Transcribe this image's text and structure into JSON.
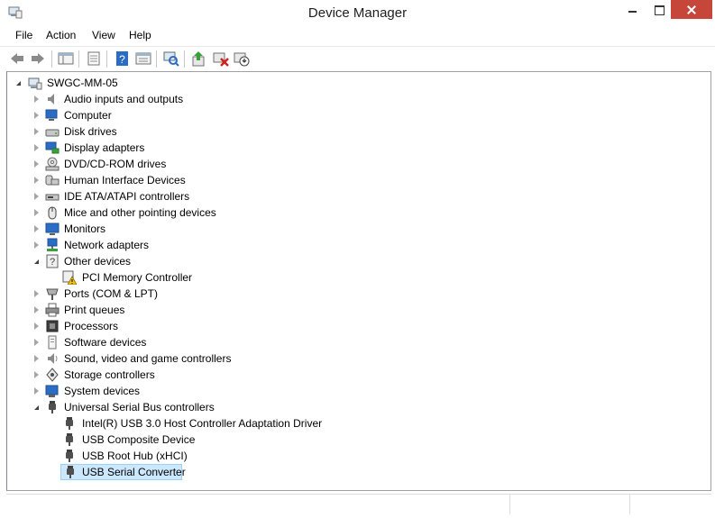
{
  "window": {
    "title": "Device Manager"
  },
  "menu": [
    "File",
    "Action",
    "View",
    "Help"
  ],
  "toolbar": [
    "back-arrow-icon",
    "forward-arrow-icon",
    "show-hide-console-tree-icon",
    "properties-icon",
    "help-icon",
    "view-icon",
    "scan-hardware-icon",
    "update-driver-icon",
    "uninstall-device-icon",
    "disable-device-icon"
  ],
  "tree": {
    "root": "SWGC-MM-05",
    "categories": [
      {
        "label": "Audio inputs and outputs",
        "icon": "speaker-icon",
        "expanded": false
      },
      {
        "label": "Computer",
        "icon": "computer-icon",
        "expanded": false
      },
      {
        "label": "Disk drives",
        "icon": "disk-drive-icon",
        "expanded": false
      },
      {
        "label": "Display adapters",
        "icon": "display-adapter-icon",
        "expanded": false
      },
      {
        "label": "DVD/CD-ROM drives",
        "icon": "dvd-drive-icon",
        "expanded": false
      },
      {
        "label": "Human Interface Devices",
        "icon": "hid-icon",
        "expanded": false
      },
      {
        "label": "IDE ATA/ATAPI controllers",
        "icon": "ide-controller-icon",
        "expanded": false
      },
      {
        "label": "Mice and other pointing devices",
        "icon": "mouse-icon",
        "expanded": false
      },
      {
        "label": "Monitors",
        "icon": "monitor-icon",
        "expanded": false
      },
      {
        "label": "Network adapters",
        "icon": "network-adapter-icon",
        "expanded": false
      },
      {
        "label": "Other devices",
        "icon": "other-devices-icon",
        "expanded": true,
        "children": [
          {
            "label": "PCI Memory Controller",
            "icon": "warning-device-icon"
          }
        ]
      },
      {
        "label": "Ports (COM & LPT)",
        "icon": "port-icon",
        "expanded": false
      },
      {
        "label": "Print queues",
        "icon": "printer-icon",
        "expanded": false
      },
      {
        "label": "Processors",
        "icon": "processor-icon",
        "expanded": false
      },
      {
        "label": "Software devices",
        "icon": "software-device-icon",
        "expanded": false
      },
      {
        "label": "Sound, video and game controllers",
        "icon": "sound-icon",
        "expanded": false
      },
      {
        "label": "Storage controllers",
        "icon": "storage-controller-icon",
        "expanded": false
      },
      {
        "label": "System devices",
        "icon": "system-device-icon",
        "expanded": false
      },
      {
        "label": "Universal Serial Bus controllers",
        "icon": "usb-icon",
        "expanded": true,
        "children": [
          {
            "label": "Intel(R) USB 3.0 Host Controller Adaptation Driver",
            "icon": "usb-icon"
          },
          {
            "label": "USB Composite Device",
            "icon": "usb-icon"
          },
          {
            "label": "USB Root Hub (xHCI)",
            "icon": "usb-icon"
          },
          {
            "label": "USB Serial Converter",
            "icon": "usb-icon",
            "selected": true
          }
        ]
      }
    ]
  },
  "colors": {
    "selection_bg": "#cce8ff",
    "selection_border": "#99d1ff",
    "close_button": "#c7463a"
  }
}
